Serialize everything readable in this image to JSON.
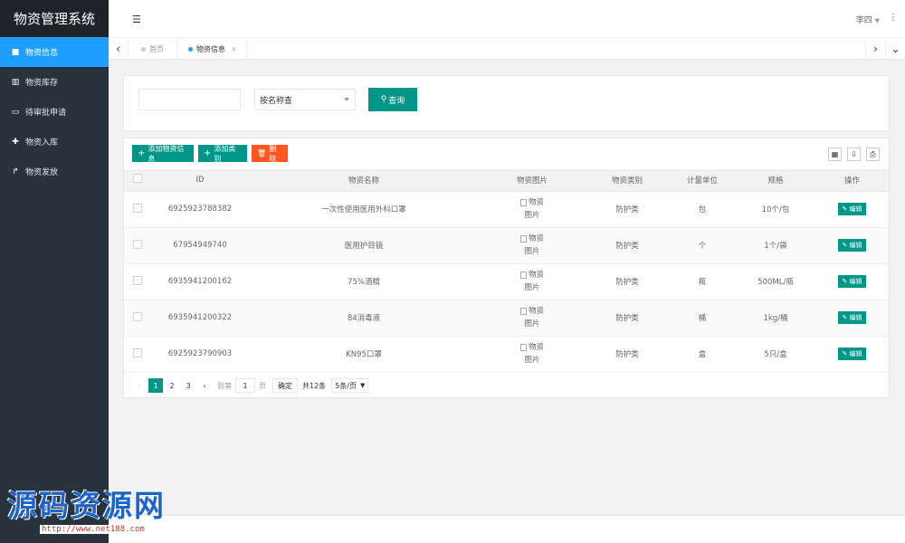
{
  "app": {
    "title": "物资管理系统"
  },
  "sidebar": {
    "items": [
      {
        "label": "物资信息",
        "icon": "book-icon",
        "active": true
      },
      {
        "label": "物资库存",
        "icon": "bar-chart-icon",
        "active": false
      },
      {
        "label": "待审批申请",
        "icon": "monitor-icon",
        "active": false
      },
      {
        "label": "物资入库",
        "icon": "plus-icon",
        "active": false
      },
      {
        "label": "物资发放",
        "icon": "share-icon",
        "active": false
      }
    ]
  },
  "header": {
    "user": "李四"
  },
  "tabs": [
    {
      "label": "首页",
      "active": false
    },
    {
      "label": "物资信息",
      "active": true
    }
  ],
  "search": {
    "input_value": "",
    "select_value": "按名称查",
    "query_label": "查询"
  },
  "toolbar": {
    "add_info_label": "添加物资信息",
    "add_category_label": "添加类别",
    "delete_label": "删除"
  },
  "table": {
    "headers": [
      "ID",
      "物资名称",
      "物资图片",
      "物资类别",
      "计量单位",
      "规格",
      "操作"
    ],
    "rows": [
      {
        "id": "6925923788382",
        "name": "一次性使用医用外科口罩",
        "image_alt": "物资图片",
        "category": "防护类",
        "unit": "包",
        "spec": "10个/包",
        "action": "编辑"
      },
      {
        "id": "67954949740",
        "name": "医用护目镜",
        "image_alt": "物资图片",
        "category": "防护类",
        "unit": "个",
        "spec": "1个/袋",
        "action": "编辑"
      },
      {
        "id": "6935941200162",
        "name": "75%酒精",
        "image_alt": "物资图片",
        "category": "防护类",
        "unit": "瓶",
        "spec": "500ML/瓶",
        "action": "编辑"
      },
      {
        "id": "6935941200322",
        "name": "84消毒液",
        "image_alt": "物资图片",
        "category": "防护类",
        "unit": "桶",
        "spec": "1kg/桶",
        "action": "编辑"
      },
      {
        "id": "6925923790903",
        "name": "KN95口罩",
        "image_alt": "物资图片",
        "category": "防护类",
        "unit": "盒",
        "spec": "5只/盒",
        "action": "编辑"
      }
    ]
  },
  "pagination": {
    "pages": [
      "1",
      "2",
      "3"
    ],
    "current": "1",
    "goto_prefix": "到第",
    "goto_value": "1",
    "goto_suffix": "页",
    "confirm_label": "确定",
    "total_label": "共12条",
    "page_size": "5条/页"
  },
  "watermark": {
    "title": "源码资源网",
    "url": "http://www.net188.com"
  },
  "colors": {
    "primary": "#009688",
    "danger": "#ff5722",
    "active_nav": "#1e9fff",
    "sidebar_bg": "#28333e"
  }
}
